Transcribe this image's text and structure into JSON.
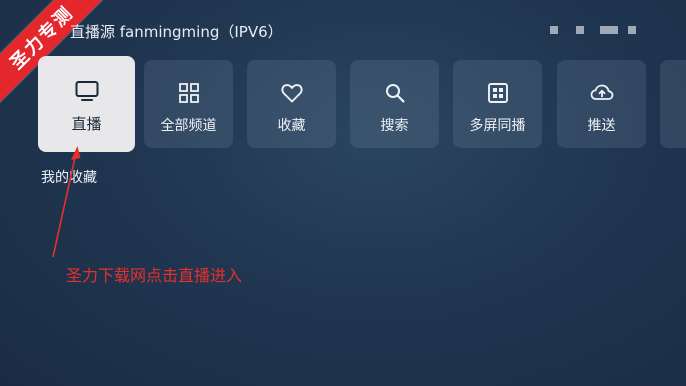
{
  "header": {
    "source_title": "直播源 fanmingming（IPV6）"
  },
  "menu": {
    "items": [
      {
        "label": "直播",
        "icon": "tv-icon",
        "selected": true
      },
      {
        "label": "全部频道",
        "icon": "grid-icon",
        "selected": false
      },
      {
        "label": "收藏",
        "icon": "heart-icon",
        "selected": false
      },
      {
        "label": "搜索",
        "icon": "search-icon",
        "selected": false
      },
      {
        "label": "多屏同播",
        "icon": "multiscreen-icon",
        "selected": false
      },
      {
        "label": "推送",
        "icon": "cloud-upload-icon",
        "selected": false
      }
    ]
  },
  "section": {
    "favorites_label": "我的收藏"
  },
  "annotation": {
    "text": "圣力下载网点击直播进入",
    "color": "#e8302a"
  },
  "watermark": {
    "text": "圣力专测",
    "color": "#e4272d"
  }
}
